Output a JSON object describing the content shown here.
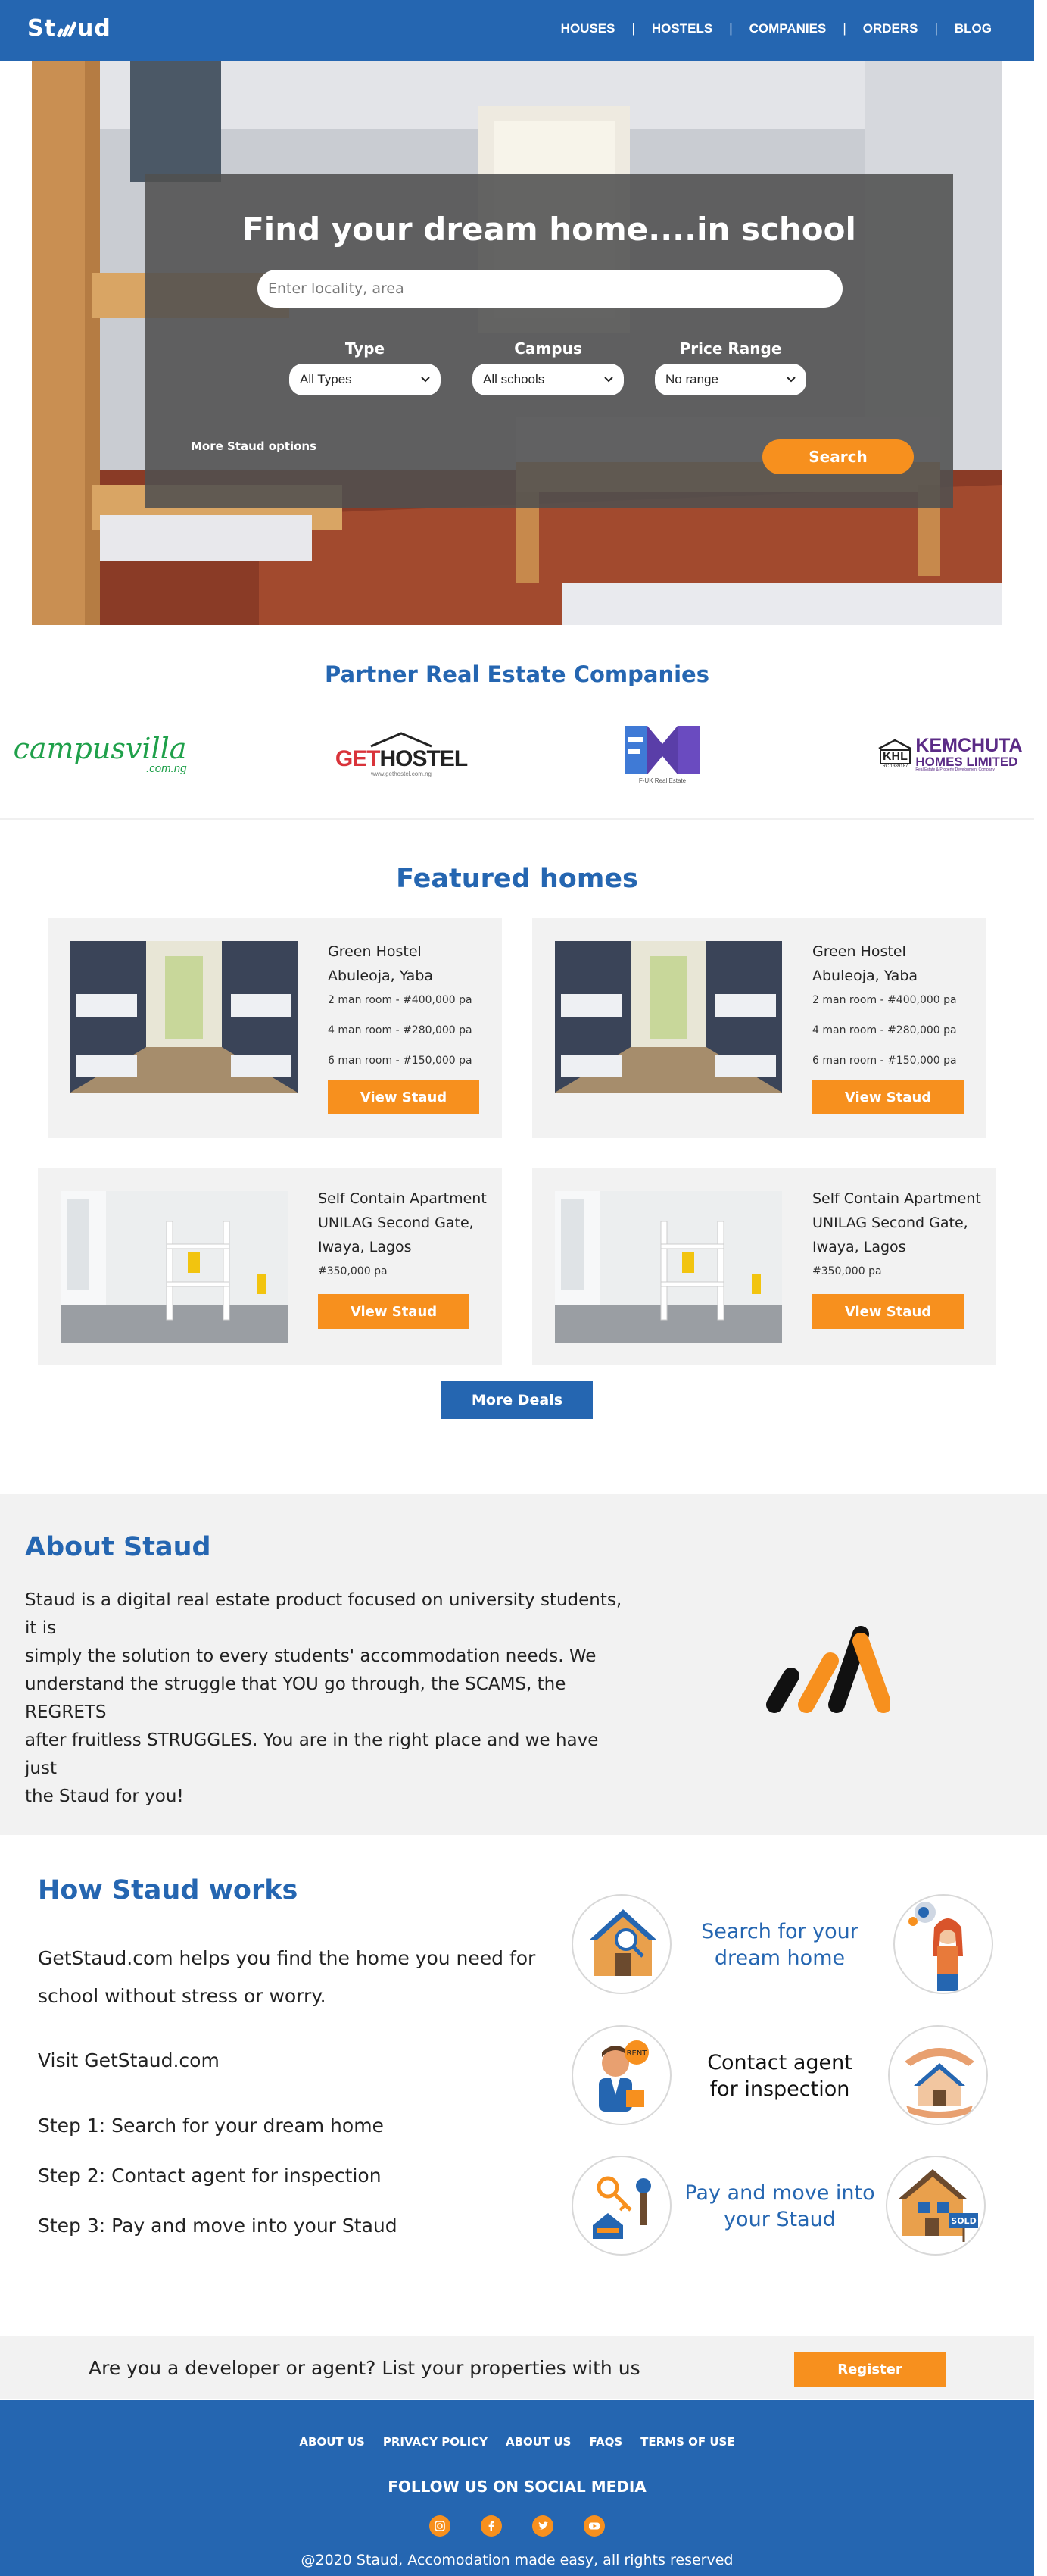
{
  "navbar": {
    "logo": "Staud",
    "links": [
      "HOUSES",
      "HOSTELS",
      "COMPANIES",
      "ORDERS",
      "BLOG"
    ]
  },
  "hero": {
    "title": "Find your dream home....in school",
    "search_placeholder": "Enter locality, area",
    "filters": [
      {
        "label": "Type",
        "value": "All Types"
      },
      {
        "label": "Campus",
        "value": "All schools"
      },
      {
        "label": "Price Range",
        "value": "No range"
      }
    ],
    "more_options": "More Staud options",
    "search_button": "Search"
  },
  "partners": {
    "title": "Partner Real Estate Companies",
    "logos": [
      {
        "name": "campusvilla",
        "suffix": ".com.ng"
      },
      {
        "name": "GETHOSTEL",
        "sub": "www.gethostel.com.ng"
      },
      {
        "name": "FM",
        "sub": "F-UK Real Estate"
      },
      {
        "name": "KEMCHUTA",
        "line2": "HOMES LIMITED",
        "badge": "KHL",
        "rc": "RC 1389187",
        "sub": "Real Estate & Property Development Company"
      }
    ]
  },
  "featured": {
    "title": "Featured homes",
    "cards": [
      {
        "title_lines": [
          "Green Hostel",
          "Abuleoja, Yaba"
        ],
        "details": [
          "2 man room - #400,000 pa",
          "4 man room - #280,000 pa",
          "6 man room - #150,000 pa"
        ],
        "button": "View Staud"
      },
      {
        "title_lines": [
          "Green Hostel",
          "Abuleoja, Yaba"
        ],
        "details": [
          "2 man room - #400,000 pa",
          "4 man room - #280,000 pa",
          "6 man room - #150,000 pa"
        ],
        "button": "View Staud"
      },
      {
        "title_lines": [
          "Self Contain Apartment",
          "UNILAG Second Gate,",
          "Iwaya, Lagos"
        ],
        "details": [
          "#350,000 pa"
        ],
        "button": "View Staud"
      },
      {
        "title_lines": [
          "Self Contain Apartment",
          "UNILAG Second Gate,",
          "Iwaya, Lagos"
        ],
        "details": [
          "#350,000 pa"
        ],
        "button": "View Staud"
      }
    ],
    "more_button": "More Deals"
  },
  "about": {
    "title": "About Staud",
    "lines": [
      "Staud is a digital real estate product focused on university students, it is",
      "simply the solution to every students' accommodation needs. We",
      "understand the struggle that YOU go through, the SCAMS, the REGRETS",
      "after fruitless STRUGGLES. You are in the right place and we have just",
      "the Staud for you!"
    ]
  },
  "how": {
    "title": "How Staud works",
    "intro_lines": [
      "GetStaud.com helps you find the home you need for",
      "school without stress or worry."
    ],
    "visit": "Visit GetStaud.com",
    "steps": [
      "Step 1: Search for your dream home",
      "Step 2: Contact agent for inspection",
      "Step 3: Pay and move into your Staud"
    ],
    "cards": [
      {
        "lines": [
          "Search for your",
          "dream home"
        ],
        "color": "#2566b1"
      },
      {
        "lines": [
          "Contact agent",
          "for inspection"
        ],
        "color": "#111111"
      },
      {
        "lines": [
          "Pay and move into",
          "your Staud"
        ],
        "color": "#2566b1"
      }
    ],
    "icon_texts": {
      "rent": "RENT",
      "sold": "SOLD"
    }
  },
  "register": {
    "text": "Are you a developer or agent? List your properties with us",
    "button": "Register"
  },
  "footer": {
    "links": [
      "ABOUT US",
      "PRIVACY POLICY",
      "ABOUT US",
      "FAQS",
      "TERMS OF USE"
    ],
    "follow": "FOLLOW US ON SOCIAL MEDIA",
    "socials": [
      "instagram-icon",
      "facebook-icon",
      "twitter-icon",
      "youtube-icon"
    ],
    "copyright": "@2020 Staud, Accomodation made easy, all rights reserved"
  },
  "colors": {
    "brand_blue": "#2566b1",
    "accent_orange": "#f7901e",
    "light_gray": "#f2f2f2"
  }
}
